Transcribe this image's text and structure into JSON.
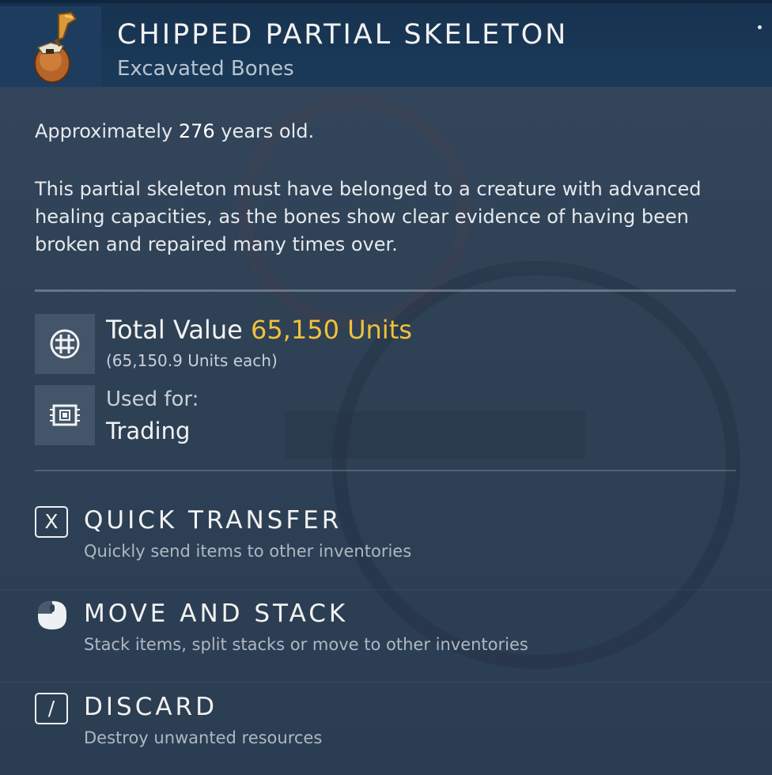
{
  "header": {
    "title": "CHIPPED PARTIAL SKELETON",
    "subtitle": "Excavated Bones",
    "item_icon": "bone-fragment-icon"
  },
  "description": {
    "age_prefix": "Approximately ",
    "age_value": "276",
    "age_suffix": " years old.",
    "text": "This partial skeleton must have belonged to a creature with advanced healing capacities, as the bones show clear evidence of having been broken and repaired many times over."
  },
  "value": {
    "label": "Total Value ",
    "amount": "65,150 Units",
    "each": "(65,150.9 Units each)",
    "icon": "units-currency-icon"
  },
  "usage": {
    "label": "Used for:",
    "value": "Trading",
    "icon": "chip-icon"
  },
  "actions": [
    {
      "key": "X",
      "title": "QUICK TRANSFER",
      "description": "Quickly send items to other inventories"
    },
    {
      "key_icon": "mouse-left-click-icon",
      "title": "MOVE AND STACK",
      "description": "Stack items, split stacks or move to other inventories"
    },
    {
      "key": "/",
      "title": "DISCARD",
      "description": "Destroy unwanted resources"
    }
  ],
  "colors": {
    "header_bg": "#1b3a5a",
    "panel_bg": "#2f4155",
    "value_accent": "#f0c23a",
    "text_primary": "#f2f2f2",
    "text_secondary": "#aeb8c3"
  }
}
